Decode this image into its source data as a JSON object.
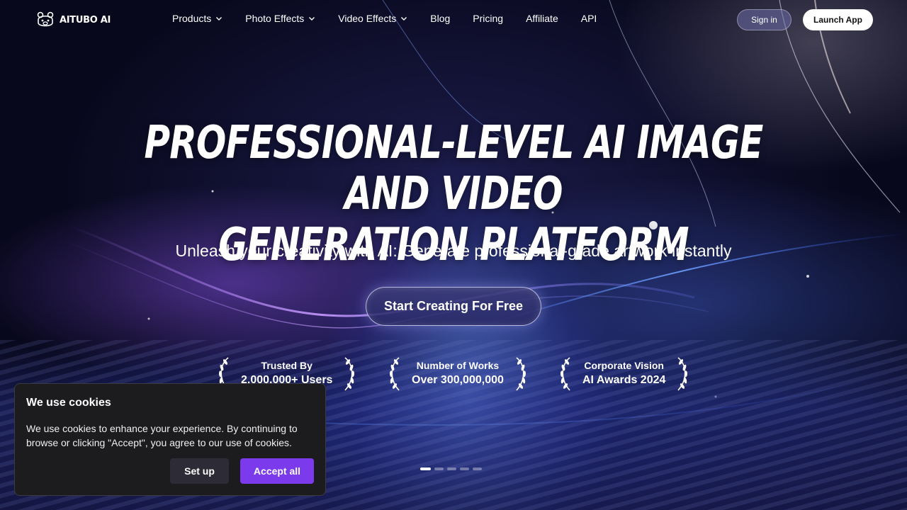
{
  "brand": {
    "name": "AITUBO AI",
    "logo_icon": "bear-icon"
  },
  "nav": {
    "items": [
      {
        "label": "Products",
        "has_dropdown": true
      },
      {
        "label": "Photo Effects",
        "has_dropdown": true
      },
      {
        "label": "Video Effects",
        "has_dropdown": true
      },
      {
        "label": "Blog",
        "has_dropdown": false
      },
      {
        "label": "Pricing",
        "has_dropdown": false
      },
      {
        "label": "Affiliate",
        "has_dropdown": false
      },
      {
        "label": "API",
        "has_dropdown": false
      }
    ],
    "sign_in": "Sign in",
    "launch_app": "Launch App"
  },
  "hero": {
    "title_line1": "PROFESSIONAL-LEVEL AI IMAGE AND VIDEO",
    "title_line2": "GENERATION PLATFORM",
    "subtitle": "Unleash your creativity with AI: Generate professional-grade artwork instantly",
    "cta": "Start Creating For Free"
  },
  "awards": [
    {
      "line1": "Trusted By",
      "line2": "2,000,000+ Users"
    },
    {
      "line1": "Number of Works",
      "line2": "Over 300,000,000"
    },
    {
      "line1": "Corporate Vision",
      "line2": "AI Awards 2024"
    }
  ],
  "slider": {
    "count": 5,
    "active_index": 0
  },
  "cookie": {
    "title": "We use cookies",
    "text": "We use cookies to enhance your experience. By continuing to browse or clicking \"Accept\", you agree to our use of cookies.",
    "setup": "Set up",
    "accept": "Accept all"
  },
  "colors": {
    "accent": "#7c3aed",
    "cookie_bg": "#1c1c1f",
    "setup_bg": "#2d2b36"
  }
}
